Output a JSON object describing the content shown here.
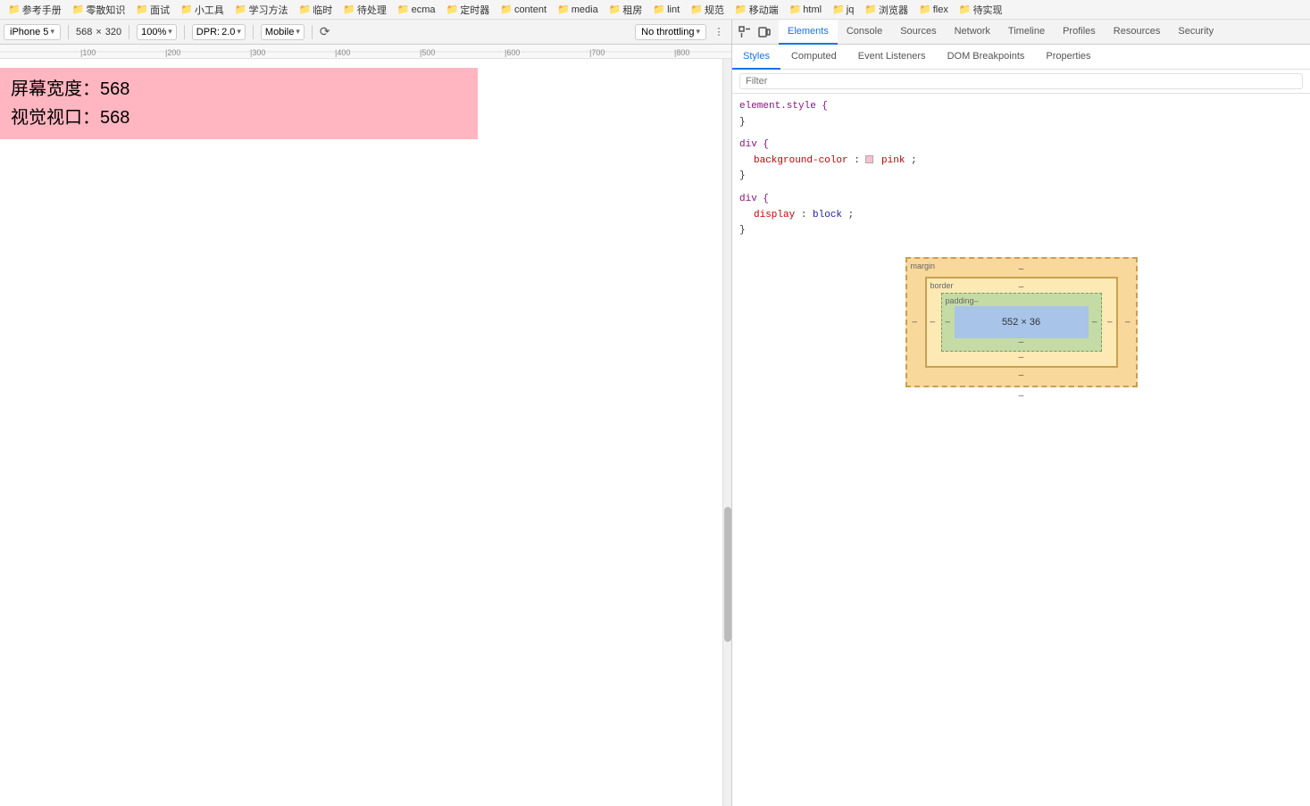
{
  "bookmarks": {
    "items": [
      {
        "label": "参考手册",
        "icon": "folder"
      },
      {
        "label": "零散知识",
        "icon": "folder"
      },
      {
        "label": "面试",
        "icon": "folder"
      },
      {
        "label": "小工具",
        "icon": "folder"
      },
      {
        "label": "学习方法",
        "icon": "folder"
      },
      {
        "label": "临时",
        "icon": "folder"
      },
      {
        "label": "待处理",
        "icon": "folder"
      },
      {
        "label": "ecma",
        "icon": "folder"
      },
      {
        "label": "定时器",
        "icon": "folder"
      },
      {
        "label": "content",
        "icon": "folder"
      },
      {
        "label": "media",
        "icon": "folder"
      },
      {
        "label": "租房",
        "icon": "folder"
      },
      {
        "label": "lint",
        "icon": "folder"
      },
      {
        "label": "规范",
        "icon": "folder"
      },
      {
        "label": "移动端",
        "icon": "folder"
      },
      {
        "label": "html",
        "icon": "folder"
      },
      {
        "label": "jq",
        "icon": "folder"
      },
      {
        "label": "浏览器",
        "icon": "folder"
      },
      {
        "label": "flex",
        "icon": "folder"
      },
      {
        "label": "待实现",
        "icon": "folder"
      }
    ]
  },
  "devtools_toolbar": {
    "device": "iPhone 5",
    "width": "568",
    "separator": "×",
    "height": "320",
    "zoom": "100%",
    "dpr_label": "DPR:",
    "dpr_value": "2.0",
    "user_agent": "Mobile",
    "throttle": "No throttling",
    "chevron": "▾"
  },
  "page": {
    "content_line1": "屏幕宽度：568",
    "content_line2": "视觉视口：568"
  },
  "devtools": {
    "tabs": [
      {
        "label": "Elements",
        "active": true
      },
      {
        "label": "Console",
        "active": false
      },
      {
        "label": "Sources",
        "active": false
      },
      {
        "label": "Network",
        "active": false
      },
      {
        "label": "Timeline",
        "active": false
      },
      {
        "label": "Profiles",
        "active": false
      },
      {
        "label": "Resources",
        "active": false
      },
      {
        "label": "Security",
        "active": false
      }
    ],
    "subtabs": [
      {
        "label": "Styles",
        "active": true
      },
      {
        "label": "Computed",
        "active": false
      },
      {
        "label": "Event Listeners",
        "active": false
      },
      {
        "label": "DOM Breakpoints",
        "active": false
      },
      {
        "label": "Properties",
        "active": false
      }
    ],
    "filter_placeholder": "Filter",
    "css_rules": [
      {
        "selector": "element.style {",
        "properties": [],
        "close": "}"
      },
      {
        "selector": "div {",
        "properties": [
          {
            "name": "background-color",
            "colon": ":",
            "value": "pink",
            "color_swatch": true
          }
        ],
        "close": "}"
      },
      {
        "selector": "div {",
        "properties": [
          {
            "name": "display",
            "colon": ":",
            "value": "block"
          }
        ],
        "close": "}"
      }
    ],
    "box_model": {
      "margin_label": "margin",
      "margin_dash": "–",
      "border_label": "border",
      "border_dash": "–",
      "padding_label": "padding–",
      "content_size": "552 × 36",
      "top": "–",
      "bottom": "–",
      "left": "–",
      "right": "–",
      "margin_bottom_dash": "–",
      "outer_bottom": "–"
    }
  },
  "ruler": {
    "marks": [
      "100",
      "200",
      "300",
      "400",
      "500",
      "600",
      "700",
      "800"
    ]
  }
}
